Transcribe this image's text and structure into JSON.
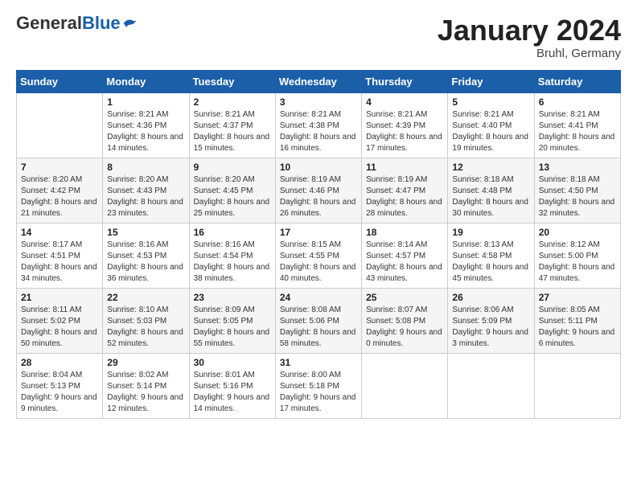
{
  "logo": {
    "general": "General",
    "blue": "Blue"
  },
  "title": {
    "month": "January 2024",
    "location": "Bruhl, Germany"
  },
  "days_of_week": [
    "Sunday",
    "Monday",
    "Tuesday",
    "Wednesday",
    "Thursday",
    "Friday",
    "Saturday"
  ],
  "weeks": [
    [
      {
        "day": "",
        "sunrise": "",
        "sunset": "",
        "daylight": ""
      },
      {
        "day": "1",
        "sunrise": "Sunrise: 8:21 AM",
        "sunset": "Sunset: 4:36 PM",
        "daylight": "Daylight: 8 hours and 14 minutes."
      },
      {
        "day": "2",
        "sunrise": "Sunrise: 8:21 AM",
        "sunset": "Sunset: 4:37 PM",
        "daylight": "Daylight: 8 hours and 15 minutes."
      },
      {
        "day": "3",
        "sunrise": "Sunrise: 8:21 AM",
        "sunset": "Sunset: 4:38 PM",
        "daylight": "Daylight: 8 hours and 16 minutes."
      },
      {
        "day": "4",
        "sunrise": "Sunrise: 8:21 AM",
        "sunset": "Sunset: 4:39 PM",
        "daylight": "Daylight: 8 hours and 17 minutes."
      },
      {
        "day": "5",
        "sunrise": "Sunrise: 8:21 AM",
        "sunset": "Sunset: 4:40 PM",
        "daylight": "Daylight: 8 hours and 19 minutes."
      },
      {
        "day": "6",
        "sunrise": "Sunrise: 8:21 AM",
        "sunset": "Sunset: 4:41 PM",
        "daylight": "Daylight: 8 hours and 20 minutes."
      }
    ],
    [
      {
        "day": "7",
        "sunrise": "Sunrise: 8:20 AM",
        "sunset": "Sunset: 4:42 PM",
        "daylight": "Daylight: 8 hours and 21 minutes."
      },
      {
        "day": "8",
        "sunrise": "Sunrise: 8:20 AM",
        "sunset": "Sunset: 4:43 PM",
        "daylight": "Daylight: 8 hours and 23 minutes."
      },
      {
        "day": "9",
        "sunrise": "Sunrise: 8:20 AM",
        "sunset": "Sunset: 4:45 PM",
        "daylight": "Daylight: 8 hours and 25 minutes."
      },
      {
        "day": "10",
        "sunrise": "Sunrise: 8:19 AM",
        "sunset": "Sunset: 4:46 PM",
        "daylight": "Daylight: 8 hours and 26 minutes."
      },
      {
        "day": "11",
        "sunrise": "Sunrise: 8:19 AM",
        "sunset": "Sunset: 4:47 PM",
        "daylight": "Daylight: 8 hours and 28 minutes."
      },
      {
        "day": "12",
        "sunrise": "Sunrise: 8:18 AM",
        "sunset": "Sunset: 4:48 PM",
        "daylight": "Daylight: 8 hours and 30 minutes."
      },
      {
        "day": "13",
        "sunrise": "Sunrise: 8:18 AM",
        "sunset": "Sunset: 4:50 PM",
        "daylight": "Daylight: 8 hours and 32 minutes."
      }
    ],
    [
      {
        "day": "14",
        "sunrise": "Sunrise: 8:17 AM",
        "sunset": "Sunset: 4:51 PM",
        "daylight": "Daylight: 8 hours and 34 minutes."
      },
      {
        "day": "15",
        "sunrise": "Sunrise: 8:16 AM",
        "sunset": "Sunset: 4:53 PM",
        "daylight": "Daylight: 8 hours and 36 minutes."
      },
      {
        "day": "16",
        "sunrise": "Sunrise: 8:16 AM",
        "sunset": "Sunset: 4:54 PM",
        "daylight": "Daylight: 8 hours and 38 minutes."
      },
      {
        "day": "17",
        "sunrise": "Sunrise: 8:15 AM",
        "sunset": "Sunset: 4:55 PM",
        "daylight": "Daylight: 8 hours and 40 minutes."
      },
      {
        "day": "18",
        "sunrise": "Sunrise: 8:14 AM",
        "sunset": "Sunset: 4:57 PM",
        "daylight": "Daylight: 8 hours and 43 minutes."
      },
      {
        "day": "19",
        "sunrise": "Sunrise: 8:13 AM",
        "sunset": "Sunset: 4:58 PM",
        "daylight": "Daylight: 8 hours and 45 minutes."
      },
      {
        "day": "20",
        "sunrise": "Sunrise: 8:12 AM",
        "sunset": "Sunset: 5:00 PM",
        "daylight": "Daylight: 8 hours and 47 minutes."
      }
    ],
    [
      {
        "day": "21",
        "sunrise": "Sunrise: 8:11 AM",
        "sunset": "Sunset: 5:02 PM",
        "daylight": "Daylight: 8 hours and 50 minutes."
      },
      {
        "day": "22",
        "sunrise": "Sunrise: 8:10 AM",
        "sunset": "Sunset: 5:03 PM",
        "daylight": "Daylight: 8 hours and 52 minutes."
      },
      {
        "day": "23",
        "sunrise": "Sunrise: 8:09 AM",
        "sunset": "Sunset: 5:05 PM",
        "daylight": "Daylight: 8 hours and 55 minutes."
      },
      {
        "day": "24",
        "sunrise": "Sunrise: 8:08 AM",
        "sunset": "Sunset: 5:06 PM",
        "daylight": "Daylight: 8 hours and 58 minutes."
      },
      {
        "day": "25",
        "sunrise": "Sunrise: 8:07 AM",
        "sunset": "Sunset: 5:08 PM",
        "daylight": "Daylight: 9 hours and 0 minutes."
      },
      {
        "day": "26",
        "sunrise": "Sunrise: 8:06 AM",
        "sunset": "Sunset: 5:09 PM",
        "daylight": "Daylight: 9 hours and 3 minutes."
      },
      {
        "day": "27",
        "sunrise": "Sunrise: 8:05 AM",
        "sunset": "Sunset: 5:11 PM",
        "daylight": "Daylight: 9 hours and 6 minutes."
      }
    ],
    [
      {
        "day": "28",
        "sunrise": "Sunrise: 8:04 AM",
        "sunset": "Sunset: 5:13 PM",
        "daylight": "Daylight: 9 hours and 9 minutes."
      },
      {
        "day": "29",
        "sunrise": "Sunrise: 8:02 AM",
        "sunset": "Sunset: 5:14 PM",
        "daylight": "Daylight: 9 hours and 12 minutes."
      },
      {
        "day": "30",
        "sunrise": "Sunrise: 8:01 AM",
        "sunset": "Sunset: 5:16 PM",
        "daylight": "Daylight: 9 hours and 14 minutes."
      },
      {
        "day": "31",
        "sunrise": "Sunrise: 8:00 AM",
        "sunset": "Sunset: 5:18 PM",
        "daylight": "Daylight: 9 hours and 17 minutes."
      },
      {
        "day": "",
        "sunrise": "",
        "sunset": "",
        "daylight": ""
      },
      {
        "day": "",
        "sunrise": "",
        "sunset": "",
        "daylight": ""
      },
      {
        "day": "",
        "sunrise": "",
        "sunset": "",
        "daylight": ""
      }
    ]
  ]
}
